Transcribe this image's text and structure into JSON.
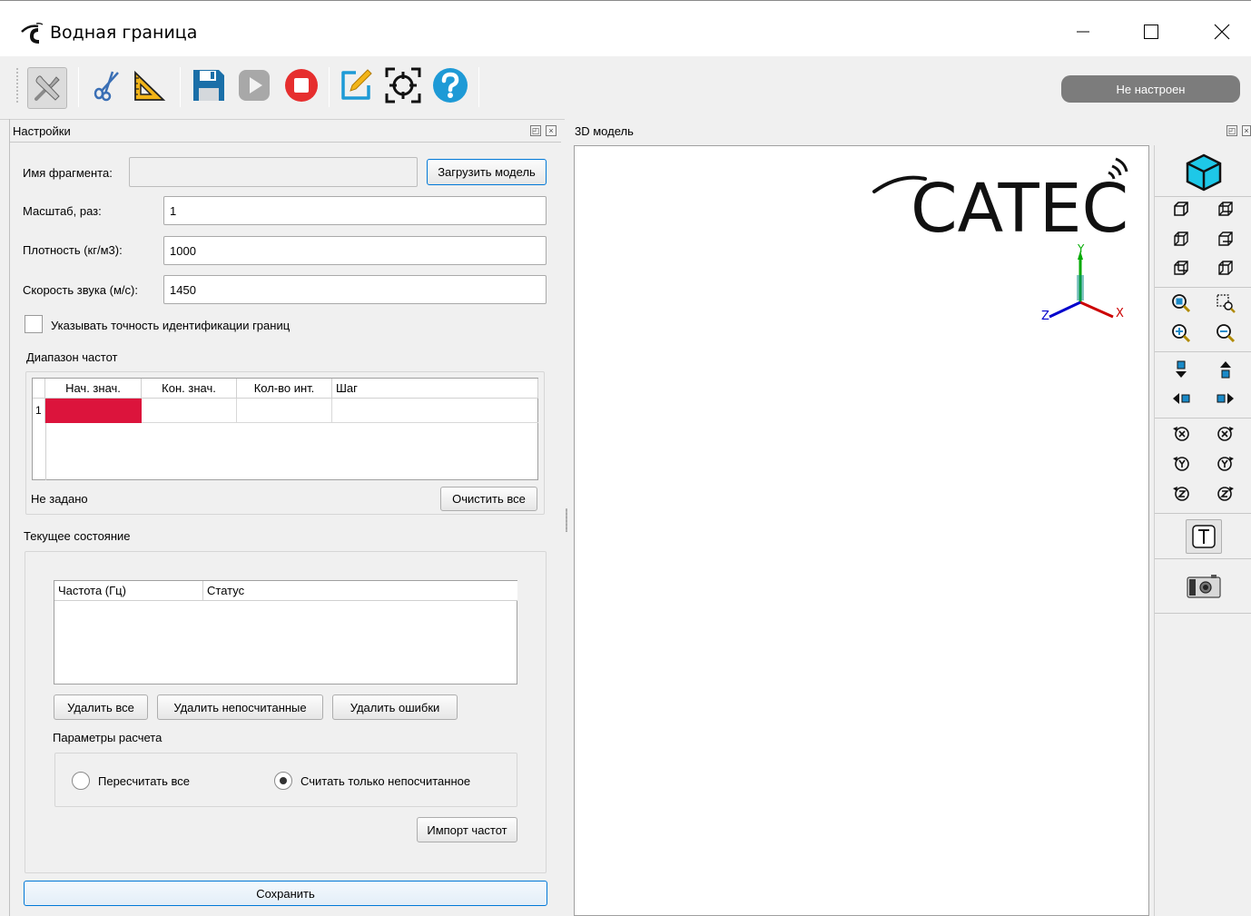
{
  "window": {
    "title": "Водная граница"
  },
  "toolbar": {
    "status_badge": "Не настроен",
    "tools": [
      {
        "icon": "settings-tools-icon",
        "active": true
      },
      {
        "icon": "scissors-icon"
      },
      {
        "icon": "ruler-triangle-icon"
      },
      {
        "icon": "save-icon"
      },
      {
        "icon": "play-icon"
      },
      {
        "icon": "stop-icon"
      },
      {
        "icon": "edit-icon"
      },
      {
        "icon": "target-icon"
      },
      {
        "icon": "help-icon"
      }
    ],
    "colors": {
      "save": "#1a6fa8",
      "stop": "#e62e2e",
      "edit": "#1e9ad6",
      "help": "#1e9ad6"
    }
  },
  "settings_panel": {
    "title": "Настройки",
    "fragment_name_label": "Имя фрагмента:",
    "fragment_name_value": "",
    "load_model_button": "Загрузить модель",
    "scale_label": "Масштаб, раз:",
    "scale_value": "1",
    "density_label": "Плотность (кг/м3):",
    "density_value": "1000",
    "sound_speed_label": "Скорость звука (м/с):",
    "sound_speed_value": "1450",
    "precision_checkbox_label": "Указывать точность идентификации границ",
    "precision_checked": false,
    "freq_range": {
      "title": "Диапазон частот",
      "columns": [
        "Нач. знач.",
        "Кон. знач.",
        "Кол-во инт.",
        "Шаг"
      ],
      "rows": [
        {
          "index": "1",
          "cells": [
            "",
            "",
            "",
            ""
          ]
        }
      ],
      "invalid_cell_color": "#dc143c",
      "status_text": "Не задано",
      "clear_button": "Очистить все"
    },
    "current_state": {
      "title": "Текущее состояние",
      "columns": [
        "Частота (Гц)",
        "Статус"
      ],
      "delete_all_button": "Удалить все",
      "delete_uncalculated_button": "Удалить непосчитанные",
      "delete_errors_button": "Удалить ошибки",
      "calc_params_title": "Параметры расчета",
      "radio_recalc_all": "Пересчитать все",
      "radio_only_uncalculated": "Считать только непосчитанное",
      "selected_radio": "only_uncalculated",
      "import_button": "Импорт частот"
    },
    "save_button": "Сохранить"
  },
  "model_panel": {
    "title": "3D модель",
    "logo_text": "CATEC",
    "axes": {
      "x": "X",
      "y": "Y",
      "z": "Z"
    },
    "axis_colors": {
      "x": "#cc0000",
      "y": "#00aa00",
      "z": "#0000cc"
    }
  },
  "view_toolbar": {
    "buttons": [
      "iso-cube-icon",
      "view-front-icon",
      "view-back-icon",
      "view-left-icon",
      "view-right-icon",
      "view-top-icon",
      "view-bottom-icon",
      "zoom-fit-icon",
      "zoom-window-icon",
      "zoom-in-icon",
      "zoom-out-icon",
      "pan-down-icon",
      "pan-up-icon",
      "pan-left-icon",
      "pan-right-icon",
      "rotate-x-neg-icon",
      "rotate-x-pos-icon",
      "rotate-y-neg-icon",
      "rotate-y-pos-icon",
      "rotate-z-neg-icon",
      "rotate-z-pos-icon",
      "text-icon",
      "camera-icon"
    ]
  }
}
